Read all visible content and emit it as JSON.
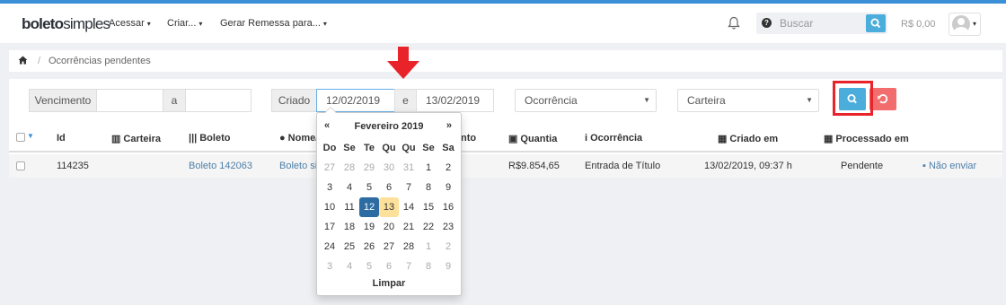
{
  "brand": {
    "logo_part1": "boleto",
    "logo_part2": "simples"
  },
  "nav": {
    "items": [
      {
        "label": "Acessar"
      },
      {
        "label": "Criar..."
      },
      {
        "label": "Gerar Remessa para..."
      }
    ],
    "search_placeholder": "Buscar",
    "balance": "R$ 0,00"
  },
  "breadcrumb": {
    "current": "Ocorrências pendentes"
  },
  "filters": {
    "vencimento_label": "Vencimento",
    "range_sep_a": "a",
    "criado_label": "Criado",
    "criado_from": "12/02/2019",
    "range_sep_e": "e",
    "criado_to": "13/02/2019",
    "ocorrencia_placeholder": "Ocorrência",
    "carteira_placeholder": "Carteira"
  },
  "table": {
    "headers": {
      "id": "Id",
      "carteira": "Carteira",
      "boleto": "Boleto",
      "nome": "Nome/",
      "vencimento": "nto",
      "quantia": "Quantia",
      "ocorrencia": "Ocorrência",
      "criado_em": "Criado em",
      "processado_em": "Processado em"
    },
    "rows": [
      {
        "id": "114235",
        "boleto": "Boleto 142063",
        "nome": "Boleto si",
        "quantia": "R$9.854,65",
        "ocorrencia": "Entrada de Título",
        "criado_em": "13/02/2019, 09:37 h",
        "processado_em": "Pendente",
        "action": "Não enviar"
      }
    ]
  },
  "datepicker": {
    "prev": "«",
    "next": "»",
    "title": "Fevereiro 2019",
    "weekdays": [
      "Do",
      "Se",
      "Te",
      "Qu",
      "Qu",
      "Se",
      "Sa"
    ],
    "days": [
      {
        "d": "27",
        "s": "other"
      },
      {
        "d": "28",
        "s": "other"
      },
      {
        "d": "29",
        "s": "other"
      },
      {
        "d": "30",
        "s": "other"
      },
      {
        "d": "31",
        "s": "other"
      },
      {
        "d": "1",
        "s": ""
      },
      {
        "d": "2",
        "s": ""
      },
      {
        "d": "3",
        "s": ""
      },
      {
        "d": "4",
        "s": ""
      },
      {
        "d": "5",
        "s": ""
      },
      {
        "d": "6",
        "s": ""
      },
      {
        "d": "7",
        "s": ""
      },
      {
        "d": "8",
        "s": ""
      },
      {
        "d": "9",
        "s": ""
      },
      {
        "d": "10",
        "s": ""
      },
      {
        "d": "11",
        "s": ""
      },
      {
        "d": "12",
        "s": "sel"
      },
      {
        "d": "13",
        "s": "today"
      },
      {
        "d": "14",
        "s": ""
      },
      {
        "d": "15",
        "s": ""
      },
      {
        "d": "16",
        "s": ""
      },
      {
        "d": "17",
        "s": ""
      },
      {
        "d": "18",
        "s": ""
      },
      {
        "d": "19",
        "s": ""
      },
      {
        "d": "20",
        "s": ""
      },
      {
        "d": "21",
        "s": ""
      },
      {
        "d": "22",
        "s": ""
      },
      {
        "d": "23",
        "s": ""
      },
      {
        "d": "24",
        "s": ""
      },
      {
        "d": "25",
        "s": ""
      },
      {
        "d": "26",
        "s": ""
      },
      {
        "d": "27",
        "s": ""
      },
      {
        "d": "28",
        "s": ""
      },
      {
        "d": "1",
        "s": "other"
      },
      {
        "d": "2",
        "s": "other"
      },
      {
        "d": "3",
        "s": "other"
      },
      {
        "d": "4",
        "s": "other"
      },
      {
        "d": "5",
        "s": "other"
      },
      {
        "d": "6",
        "s": "other"
      },
      {
        "d": "7",
        "s": "other"
      },
      {
        "d": "8",
        "s": "other"
      },
      {
        "d": "9",
        "s": "other"
      }
    ],
    "clear": "Limpar"
  },
  "colors": {
    "accent": "#4aaddb",
    "danger": "#f26d6d",
    "selected_day": "#2d6ca2",
    "today_day": "#fde19a",
    "annotation_red": "#e8232a"
  }
}
